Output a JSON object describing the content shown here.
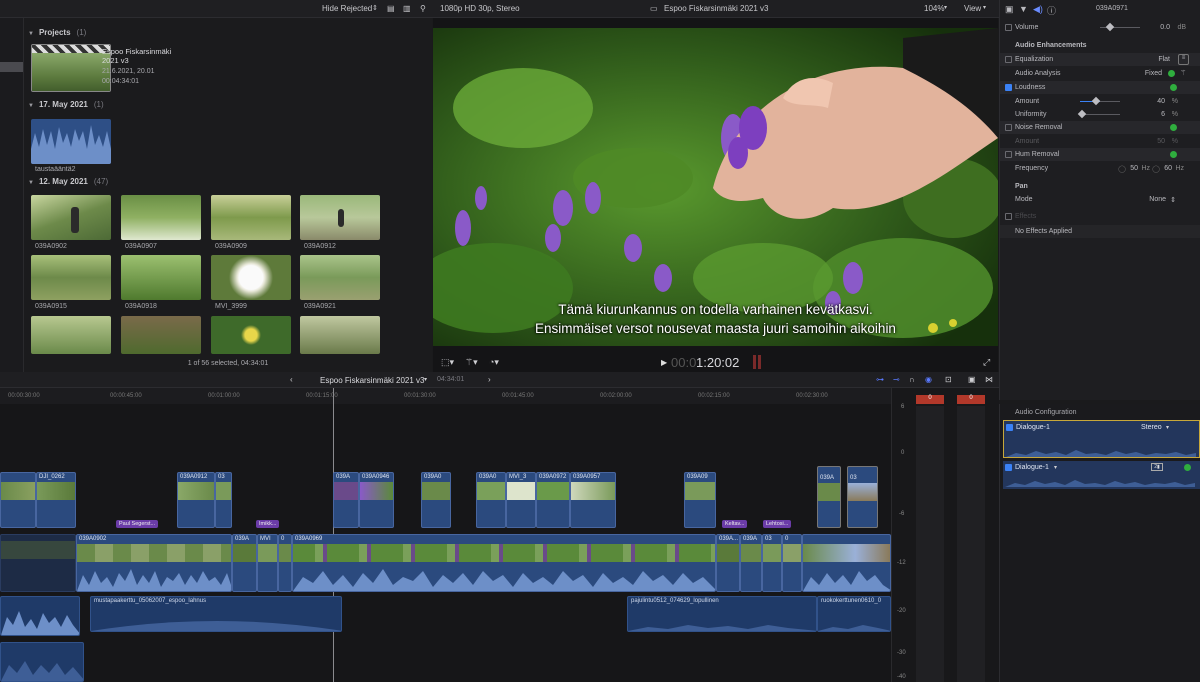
{
  "topbar": {
    "filter": "Hide Rejected",
    "format": "1080p HD 30p, Stereo",
    "project_title": "Espoo Fiskarsinmäki 2021 v3",
    "zoom": "104%",
    "view": "View",
    "clip_name": "039A0971"
  },
  "browser": {
    "projects_header": "Projects",
    "projects_count": "(1)",
    "project": {
      "name_line1": "Espoo Fiskarsinmäki",
      "name_line2": "2021 v3",
      "date": "21.6.2021, 20.01",
      "duration": "00:04:34:01"
    },
    "group1_header": "17. May 2021",
    "group1_count": "(1)",
    "group1_clip": "taustaääntä2",
    "group2_header": "12. May 2021",
    "group2_count": "(47)",
    "clips": [
      "039A0902",
      "039A0907",
      "039A0909",
      "039A0912",
      "039A0915",
      "039A0918",
      "MVI_3999",
      "039A0921"
    ],
    "footer": "1 of 56 selected, 04:34:01"
  },
  "viewer": {
    "subtitle_line1": "Tämä kiurunkannus on todella varhainen kevätkasvi.",
    "subtitle_line2": "Ensimmäiset versot nousevat maasta juuri samoihin aikoihin",
    "timecode_dim": "00:0",
    "timecode": "1:20:02"
  },
  "inspector": {
    "volume_label": "Volume",
    "volume_value": "0.0",
    "volume_unit": "dB",
    "enh_header": "Audio Enhancements",
    "eq_label": "Equalization",
    "eq_value": "Flat",
    "analysis_label": "Audio Analysis",
    "analysis_value": "Fixed",
    "loud_label": "Loudness",
    "amount_label": "Amount",
    "amount_value": "40",
    "amount_unit": "%",
    "uniform_label": "Uniformity",
    "uniform_value": "6",
    "uniform_unit": "%",
    "noise_label": "Noise Removal",
    "noise_amount_label": "Amount",
    "noise_amount_value": "50",
    "noise_amount_unit": "%",
    "hum_label": "Hum Removal",
    "freq_label": "Frequency",
    "freq_50": "50",
    "freq_60": "60",
    "hz": "Hz",
    "pan_header": "Pan",
    "mode_label": "Mode",
    "mode_value": "None",
    "effects_header": "Effects",
    "no_effects": "No Effects Applied",
    "amount_level": 0.4,
    "uniform_level": 0.06
  },
  "audio_config": {
    "header": "Audio Configuration",
    "row1_label": "Dialogue-1",
    "row1_value": "Stereo",
    "row2_label": "Dialogue-1"
  },
  "timeline": {
    "project": "Espoo Fiskarsinmäki 2021 v3",
    "duration": "04:34:01",
    "ruler": [
      "00:00:30:00",
      "00:00:45:00",
      "00:01:00:00",
      "00:01:15:00",
      "00:01:30:00",
      "00:01:45:00",
      "00:02:00:00",
      "00:02:15:00",
      "00:02:30:00"
    ],
    "top_clips": [
      "DJI_0262",
      "039A0912",
      "03",
      "039A",
      "039A0946",
      "039A0",
      "039A0",
      "MVI_3",
      "039A0972",
      "039A0957",
      "039A09",
      "039A",
      "03"
    ],
    "tags": [
      "Paul Segerst...",
      "Imikk...",
      "Keltav...",
      "Lehtosi..."
    ],
    "main_clips": [
      "039A0902",
      "039A",
      "MVI",
      "0",
      "039A0969",
      "039A...",
      "039A",
      "03",
      "0"
    ],
    "audio_clips": [
      "mustapaakerttu_05062007_espoo_lahnus",
      "pajulintu0512_074629_lopullinen",
      "ruokokerttunen0610_0"
    ],
    "meter_peaks": [
      "0",
      "0"
    ],
    "meter_scale": [
      "6",
      "0",
      "-6",
      "-12",
      "-20",
      "-30",
      "-40"
    ]
  }
}
